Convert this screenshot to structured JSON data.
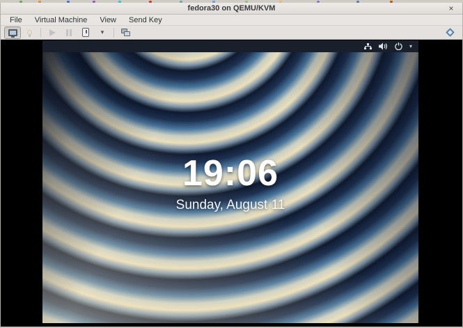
{
  "window": {
    "title": "fedora30 on QEMU/KVM",
    "close_glyph": "×"
  },
  "menubar": {
    "items": [
      "File",
      "Virtual Machine",
      "View",
      "Send Key"
    ]
  },
  "toolbar": {
    "caret_glyph": "▾",
    "buttons": [
      {
        "name": "show-graphical-console",
        "icon": "monitor-icon",
        "state": "active"
      },
      {
        "name": "show-hardware-details",
        "icon": "lightbulb-icon",
        "state": "disabled"
      },
      {
        "name": "run",
        "icon": "play-icon",
        "state": "disabled"
      },
      {
        "name": "pause",
        "icon": "pause-icon",
        "state": "disabled"
      },
      {
        "name": "shut-down",
        "icon": "power-box-icon",
        "state": "enabled"
      },
      {
        "name": "shut-down-menu",
        "icon": "caret-down-icon",
        "state": "enabled"
      },
      {
        "name": "manage-snapshots",
        "icon": "snapshots-icon",
        "state": "enabled"
      },
      {
        "name": "fullscreen",
        "icon": "fullscreen-diamond-icon",
        "state": "enabled"
      }
    ]
  },
  "guest_screen": {
    "topbar": {
      "chevron_glyph": "▾",
      "status_icons": [
        "network-icon",
        "volume-icon",
        "power-icon",
        "chevron-down-icon"
      ]
    },
    "lock_screen": {
      "time": "19:06",
      "date": "Sunday, August 11"
    },
    "palette": {
      "topbar_bg": "#1a202b",
      "ripple_navy": "#0f1a30",
      "ripple_blue": "#49779f",
      "ripple_cream": "#ecdfba",
      "clock_text": "#ffffff"
    }
  }
}
